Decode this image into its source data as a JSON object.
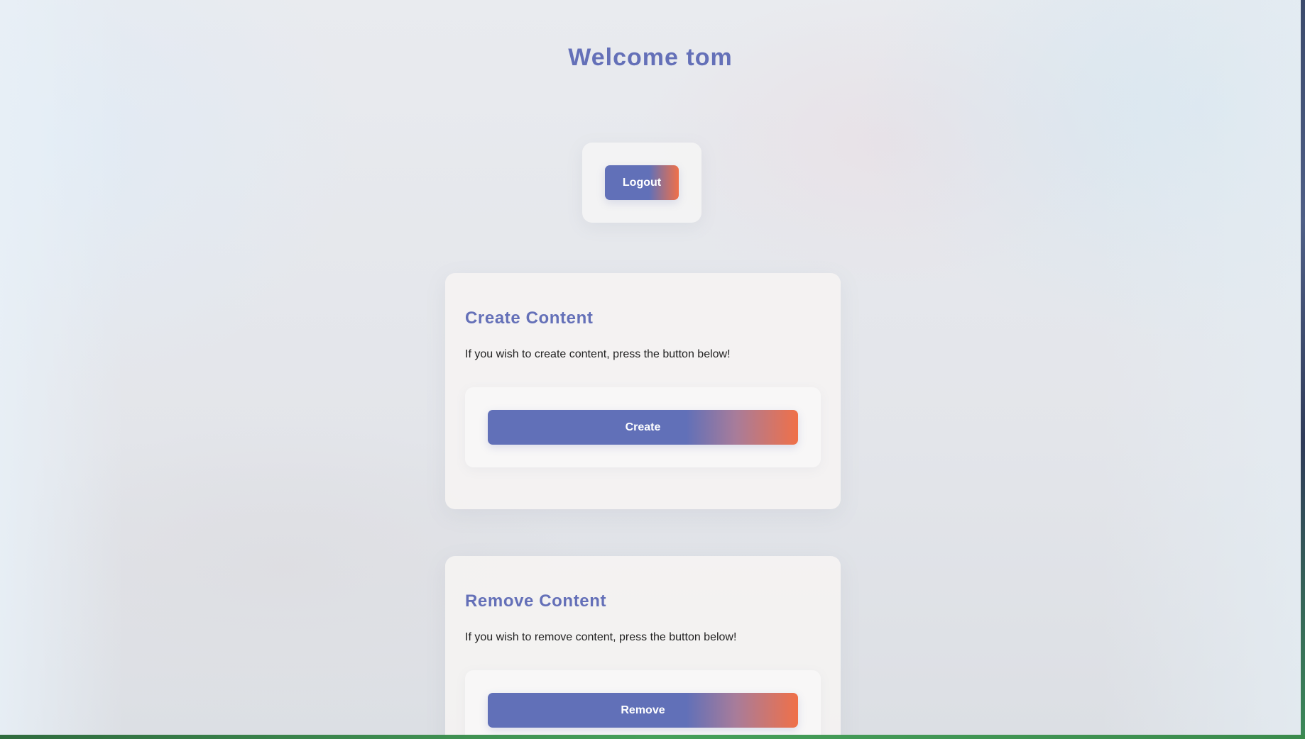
{
  "header": {
    "title": "Welcome tom"
  },
  "logout": {
    "label": "Logout"
  },
  "create_section": {
    "heading": "Create Content",
    "description": "If you wish to create content, press the button below!",
    "button_label": "Create"
  },
  "remove_section": {
    "heading": "Remove Content",
    "description": "If you wish to remove content, press the button below!",
    "button_label": "Remove"
  },
  "colors": {
    "accent": "#6470b8",
    "gradient_end": "#f07048",
    "text": "#222222"
  }
}
